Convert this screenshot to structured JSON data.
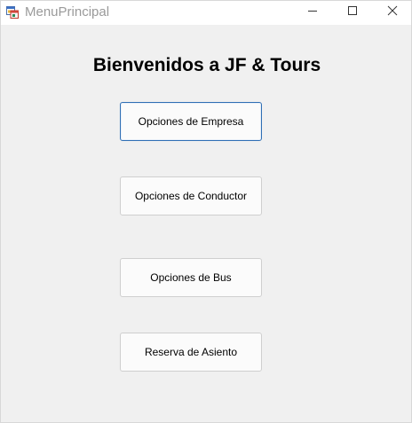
{
  "window": {
    "title": "MenuPrincipal",
    "icon": "winforms-app-icon",
    "controls": {
      "minimize_icon": "minimize-icon",
      "maximize_icon": "maximize-icon",
      "close_icon": "close-icon"
    }
  },
  "main": {
    "heading": "Bienvenidos a JF & Tours",
    "buttons": [
      {
        "label": "Opciones de Empresa",
        "focused": true
      },
      {
        "label": "Opciones de Conductor",
        "focused": false
      },
      {
        "label": "Opciones de Bus",
        "focused": false
      },
      {
        "label": "Reserva de Asiento",
        "focused": false
      }
    ]
  },
  "colors": {
    "client_background": "#f0f0f0",
    "titlebar_background": "#ffffff",
    "focus_border": "#2f6fb4",
    "button_border": "#cfcfcf"
  }
}
